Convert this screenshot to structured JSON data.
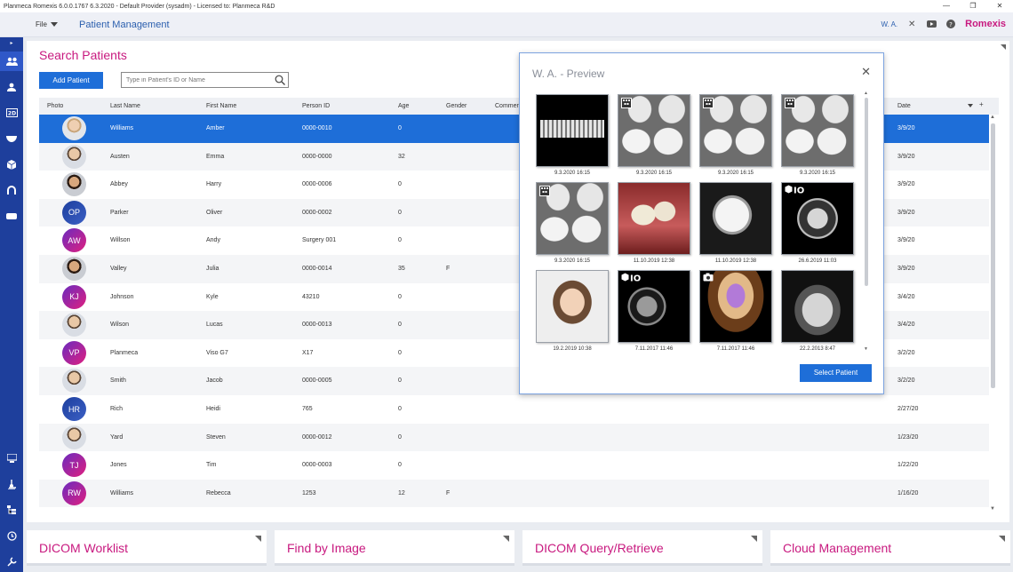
{
  "window": {
    "title": "Planmeca Romexis 6.0.0.1767 6.3.2020 - Default Provider (sysadm) - Licensed to: Planmeca R&D"
  },
  "header": {
    "file_menu": "File",
    "module_title": "Patient Management",
    "user_initials": "W. A.",
    "brand": "Romexis"
  },
  "search": {
    "title": "Search Patients",
    "add_button": "Add Patient",
    "placeholder": "Type in Patient's ID or Name"
  },
  "table": {
    "columns": [
      "Photo",
      "Last Name",
      "First Name",
      "Person ID",
      "Age",
      "Gender",
      "Commer",
      "Date"
    ],
    "rows": [
      {
        "last": "Williams",
        "first": "Amber",
        "id": "0000-0010",
        "age": "0",
        "gender": "",
        "date": "3/9/20",
        "avatar": ""
      },
      {
        "last": "Austen",
        "first": "Emma",
        "id": "0000-0000",
        "age": "32",
        "gender": "",
        "date": "3/9/20",
        "avatar": ""
      },
      {
        "last": "Abbey",
        "first": "Harry",
        "id": "0000-0006",
        "age": "0",
        "gender": "",
        "date": "3/9/20",
        "avatar": ""
      },
      {
        "last": "Parker",
        "first": "Oliver",
        "id": "0000-0002",
        "age": "0",
        "gender": "",
        "date": "3/9/20",
        "avatar": "OP"
      },
      {
        "last": "Willson",
        "first": "Andy",
        "id": "Surgery 001",
        "age": "0",
        "gender": "",
        "date": "3/9/20",
        "avatar": "AW"
      },
      {
        "last": "Valley",
        "first": "Julia",
        "id": "0000-0014",
        "age": "35",
        "gender": "F",
        "date": "3/9/20",
        "avatar": ""
      },
      {
        "last": "Johnson",
        "first": "Kyle",
        "id": "43210",
        "age": "0",
        "gender": "",
        "date": "3/4/20",
        "avatar": "KJ"
      },
      {
        "last": "Wilson",
        "first": "Lucas",
        "id": "0000-0013",
        "age": "0",
        "gender": "",
        "date": "3/4/20",
        "avatar": ""
      },
      {
        "last": "Planmeca",
        "first": "Viso G7",
        "id": "X17",
        "age": "0",
        "gender": "",
        "date": "3/2/20",
        "avatar": "VP"
      },
      {
        "last": "Smith",
        "first": "Jacob",
        "id": "0000-0005",
        "age": "0",
        "gender": "",
        "date": "3/2/20",
        "avatar": ""
      },
      {
        "last": "Rich",
        "first": "Heidi",
        "id": "765",
        "age": "0",
        "gender": "",
        "date": "2/27/20",
        "avatar": "HR"
      },
      {
        "last": "Yard",
        "first": "Steven",
        "id": "0000-0012",
        "age": "0",
        "gender": "",
        "date": "1/23/20",
        "avatar": ""
      },
      {
        "last": "Jones",
        "first": "Tim",
        "id": "0000-0003",
        "age": "0",
        "gender": "",
        "date": "1/22/20",
        "avatar": "TJ"
      },
      {
        "last": "Williams",
        "first": "Rebecca",
        "id": "1253",
        "age": "12",
        "gender": "F",
        "date": "1/16/20",
        "avatar": "RW"
      }
    ]
  },
  "preview": {
    "title": "W. A. - Preview",
    "select_button": "Select Patient",
    "images": [
      {
        "date": "9.3.2020 16:15",
        "kind": "panoramic"
      },
      {
        "date": "9.3.2020 16:15",
        "kind": "intraoral-xray"
      },
      {
        "date": "9.3.2020 16:15",
        "kind": "intraoral-xray"
      },
      {
        "date": "9.3.2020 16:15",
        "kind": "intraoral-xray"
      },
      {
        "date": "9.3.2020 16:15",
        "kind": "intraoral-xray"
      },
      {
        "date": "11.10.2019 12:38",
        "kind": "intraoral-photo"
      },
      {
        "date": "11.10.2019 12:38",
        "kind": "cephalometric"
      },
      {
        "date": "26.6.2019 11:03",
        "kind": "cbct"
      },
      {
        "date": "19.2.2019 10:38",
        "kind": "face-photo"
      },
      {
        "date": "7.11.2017 11:46",
        "kind": "cbct"
      },
      {
        "date": "7.11.2017 11:46",
        "kind": "3d-render"
      },
      {
        "date": "22.2.2013 8:47",
        "kind": "panoramic"
      }
    ]
  },
  "tiles": [
    "DICOM Worklist",
    "Find by Image",
    "DICOM Query/Retrieve",
    "Cloud Management"
  ],
  "colors": {
    "accent_blue": "#1e6ed8",
    "brand_magenta": "#c8197f",
    "sidebar": "#1e3f9c"
  }
}
